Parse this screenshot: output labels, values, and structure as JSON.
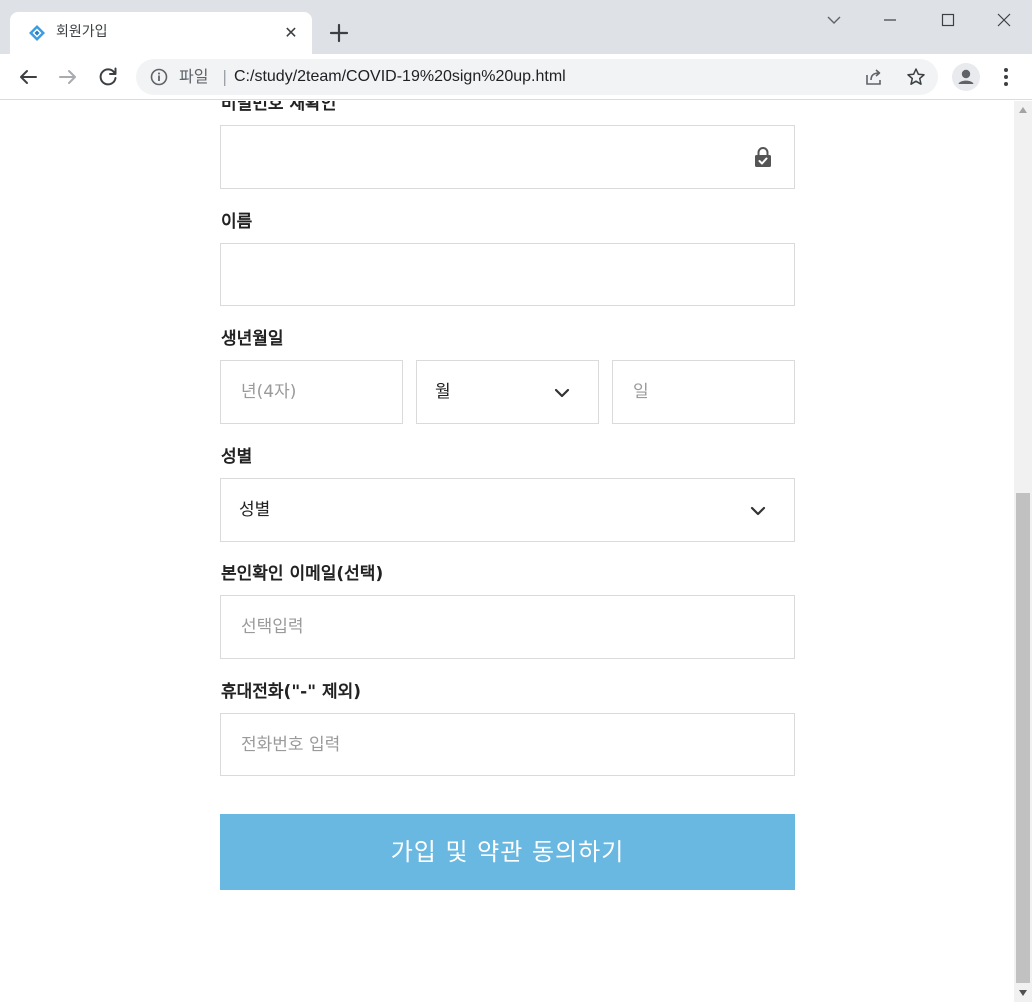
{
  "browser": {
    "tab_title": "회원가입",
    "tab_close_glyph": "✕",
    "address_scheme": "파일",
    "address_separator": "|",
    "address_url": "C:/study/2team/COVID-19%20sign%20up.html"
  },
  "form": {
    "password_confirm_label": "비밀번호 재확인",
    "name_label": "이름",
    "birth_label": "생년월일",
    "birth_year_placeholder": "년(4자)",
    "birth_month_value": "월",
    "birth_day_placeholder": "일",
    "gender_label": "성별",
    "gender_value": "성별",
    "email_label": "본인확인 이메일(선택)",
    "email_placeholder": "선택입력",
    "phone_label": "휴대전화(\"-\" 제외)",
    "phone_placeholder": "전화번호 입력",
    "submit_label": "가입 및 약관 동의하기"
  },
  "colors": {
    "submit_bg": "#69b8e2",
    "field_border": "#dadada",
    "chrome_bg": "#dee1e6"
  }
}
